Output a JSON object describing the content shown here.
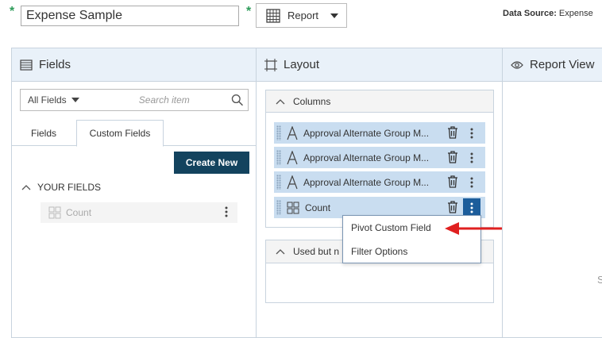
{
  "topbar": {
    "required_mark": "*",
    "report_name": "Expense Sample",
    "report_type_label": "Report",
    "data_source_label": "Data Source:",
    "data_source_value": "Expense"
  },
  "fields_panel": {
    "title": "Fields",
    "filter_selected": "All Fields",
    "search_placeholder": "Search item",
    "tabs": [
      "Fields",
      "Custom Fields"
    ],
    "create_new_label": "Create New",
    "section_label": "YOUR FIELDS",
    "items": [
      {
        "label": "Count"
      }
    ]
  },
  "layout_panel": {
    "title": "Layout",
    "columns_label": "Columns",
    "columns": [
      {
        "label": "Approval Alternate Group M...",
        "icon": "text-icon"
      },
      {
        "label": "Approval Alternate Group M...",
        "icon": "text-icon"
      },
      {
        "label": "Approval Alternate Group M...",
        "icon": "text-icon"
      },
      {
        "label": "Count",
        "icon": "grid-icon"
      }
    ],
    "used_but_label": "Used but n"
  },
  "context_menu": {
    "items": [
      "Pivot Custom Field",
      "Filter Options"
    ]
  },
  "report_view": {
    "title": "Report View",
    "partial_text": "S"
  },
  "colors": {
    "accent_dark": "#13435e",
    "active_kebab": "#1c5d9b",
    "selected_row": "#c9ddf0",
    "arrow": "#e02020",
    "required": "#2e9c5a"
  }
}
